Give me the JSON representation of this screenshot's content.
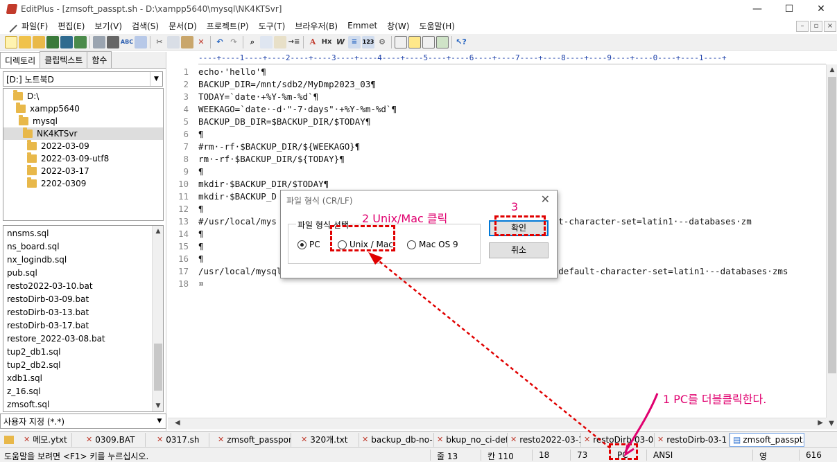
{
  "window": {
    "title": "EditPlus - [zmsoft_passpt.sh - D:\\xampp5640\\mysql\\NK4KTSvr]",
    "controls": [
      "—",
      "☐",
      "✕"
    ]
  },
  "menu": [
    "파일(F)",
    "편집(E)",
    "보기(V)",
    "검색(S)",
    "문서(D)",
    "프로젝트(P)",
    "도구(T)",
    "브라우저(B)",
    "Emmet",
    "창(W)",
    "도움말(H)"
  ],
  "left_panel": {
    "tabs": [
      "디렉토리",
      "클립텍스트",
      "함수"
    ],
    "drive": "[D:] 노트북D",
    "tree": [
      "D:\\",
      "xampp5640",
      "mysql",
      "NK4KTSvr",
      "2022-03-09",
      "2022-03-09-utf8",
      "2022-03-17",
      "2202-0309"
    ],
    "files": [
      "nnsms.sql",
      "ns_board.sql",
      "nx_logindb.sql",
      "pub.sql",
      "resto2022-03-10.bat",
      "restoDirb-03-09.bat",
      "restoDirb-03-13.bat",
      "restoDirb-03-17.bat",
      "restore_2022-03-08.bat",
      "tup2_db1.sql",
      "tup2_db2.sql",
      "xdb1.sql",
      "z_16.sql",
      "zmsoft.sql"
    ],
    "filter": "사용자 지정 (*.*)"
  },
  "editor": {
    "ruler": "----+----1----+----2----+----3----+----4----+----5----+----6----+----7----+----8----+----9----+----0----+----1----+",
    "lines": [
      {
        "n": "1",
        "text": "echo·'hello'¶"
      },
      {
        "n": "2",
        "text": "BACKUP_DIR=/mnt/sdb2/MyDmp2023_03¶"
      },
      {
        "n": "3",
        "text": "TODAY=`date·+%Y-%m-%d`¶"
      },
      {
        "n": "4",
        "text": "WEEKAGO=`date·-d·\"-7·days\"·+%Y-%m-%d`¶"
      },
      {
        "n": "5",
        "text": "BACKUP_DB_DIR=$BACKUP_DIR/$TODAY¶"
      },
      {
        "n": "6",
        "text": "¶"
      },
      {
        "n": "7",
        "text": "#rm·-rf·$BACKUP_DIR/${WEEKAGO}¶"
      },
      {
        "n": "8",
        "text": "rm·-rf·$BACKUP_DIR/${TODAY}¶"
      },
      {
        "n": "9",
        "text": "¶"
      },
      {
        "n": "10",
        "text": "mkdir·$BACKUP_DIR/$TODAY¶"
      },
      {
        "n": "11",
        "text": "mkdir·$BACKUP_D"
      },
      {
        "n": "12",
        "text": "¶"
      },
      {
        "n": "13",
        "text": "#/usr/local/mys                                          nfo·--default-character-set=latin1·--databases·zm"
      },
      {
        "n": "14",
        "text": "¶"
      },
      {
        "n": "15",
        "text": "¶"
      },
      {
        "n": "16",
        "text": "¶"
      },
      {
        "n": "17",
        "text": "/usr/local/mysql4122/bin/mysqldump·-u·xe200a·-p··--add-drop-table··--default-character-set=latin1·--databases·zms"
      },
      {
        "n": "18",
        "text": "¤"
      }
    ]
  },
  "dialog": {
    "title": "파일 형식 (CR/LF)",
    "group_label": "파일 형식 선택",
    "options": [
      "PC",
      "Unix / Mac",
      "Mac OS 9"
    ],
    "selected": "PC",
    "ok": "확인",
    "cancel": "취소"
  },
  "doc_tabs": [
    "메모.ytxt",
    "0309.BAT",
    "0317.sh",
    "zmsoft_passpor",
    "320개.txt",
    "backup_db-no-",
    "bkup_no_ci-def",
    "resto2022-03-1",
    "restoDirb-03-0",
    "restoDirb-03-1",
    "zmsoft_passpt.s"
  ],
  "status": {
    "help": "도움말을 보려면 <F1> 키를 누르십시오.",
    "line": "줄 13",
    "col": "칸 110",
    "n1": "18",
    "n2": "73",
    "format": "PC",
    "encoding": "ANSI",
    "lang": "영",
    "size": "616"
  },
  "annotations": {
    "step1": "1  PC를 더블클릭한다.",
    "step2": "2 Unix/Mac 클릭",
    "step3": "3"
  },
  "colors": {
    "annotation": "#e0006f",
    "dashed_box": "#e00000",
    "ruler": "#1a3ea8"
  }
}
